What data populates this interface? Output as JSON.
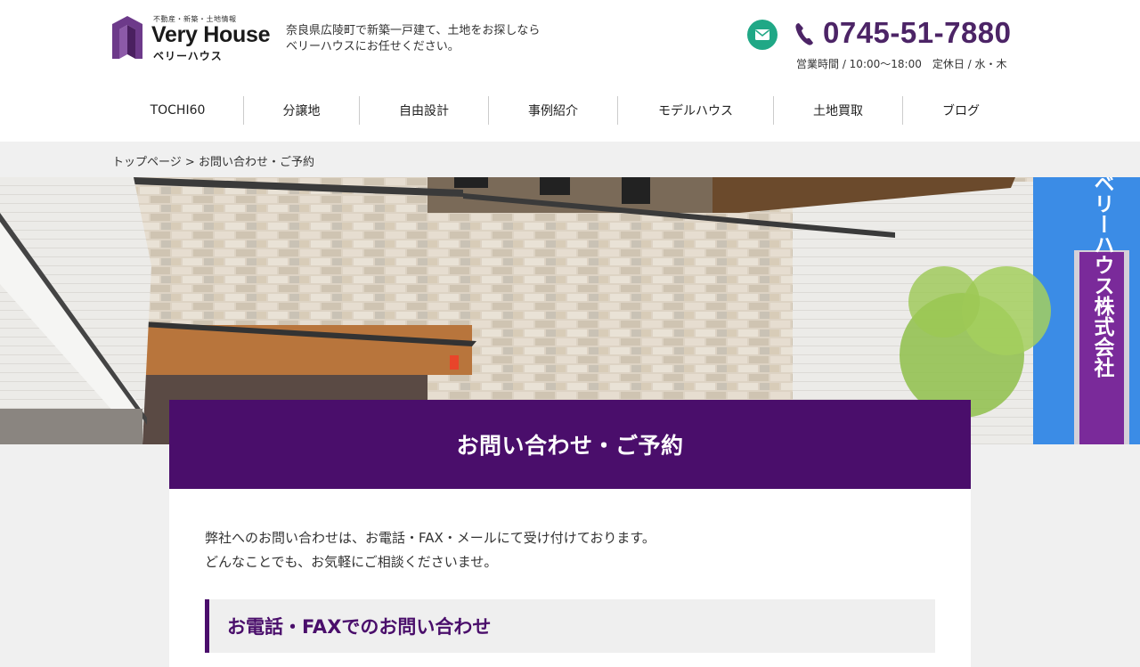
{
  "header": {
    "logo": {
      "tagline": "不動産・新築・土地情報",
      "brand": "Very House",
      "kana": "ベリーハウス"
    },
    "intro_line1": "奈良県広陵町で新築一戸建て、土地をお探しなら",
    "intro_line2": "ベリーハウスにお任せください。",
    "phone": "0745-51-7880",
    "hours": "営業時間 / 10:00～18:00　定休日 / 水・木",
    "accent_color": "#4a0e6b",
    "mail_button_color": "#20a886"
  },
  "nav": {
    "items": [
      {
        "label": "TOCHI60"
      },
      {
        "label": "分譲地"
      },
      {
        "label": "自由設計"
      },
      {
        "label": "事例紹介"
      },
      {
        "label": "モデルハウス"
      },
      {
        "label": "土地買取"
      },
      {
        "label": "ブログ"
      }
    ]
  },
  "breadcrumb": {
    "home": "トップページ",
    "separator": ">",
    "current": "お問い合わせ・ご予約"
  },
  "hero": {
    "sign_text": "ベリーハウス株式会社"
  },
  "main": {
    "title": "お問い合わせ・ご予約",
    "lead_line1": "弊社へのお問い合わせは、お電話・FAX・メールにて受け付けております。",
    "lead_line2": "どんなことでも、お気軽にご相談くださいませ。",
    "section_title": "お電話・FAXでのお問い合わせ"
  }
}
